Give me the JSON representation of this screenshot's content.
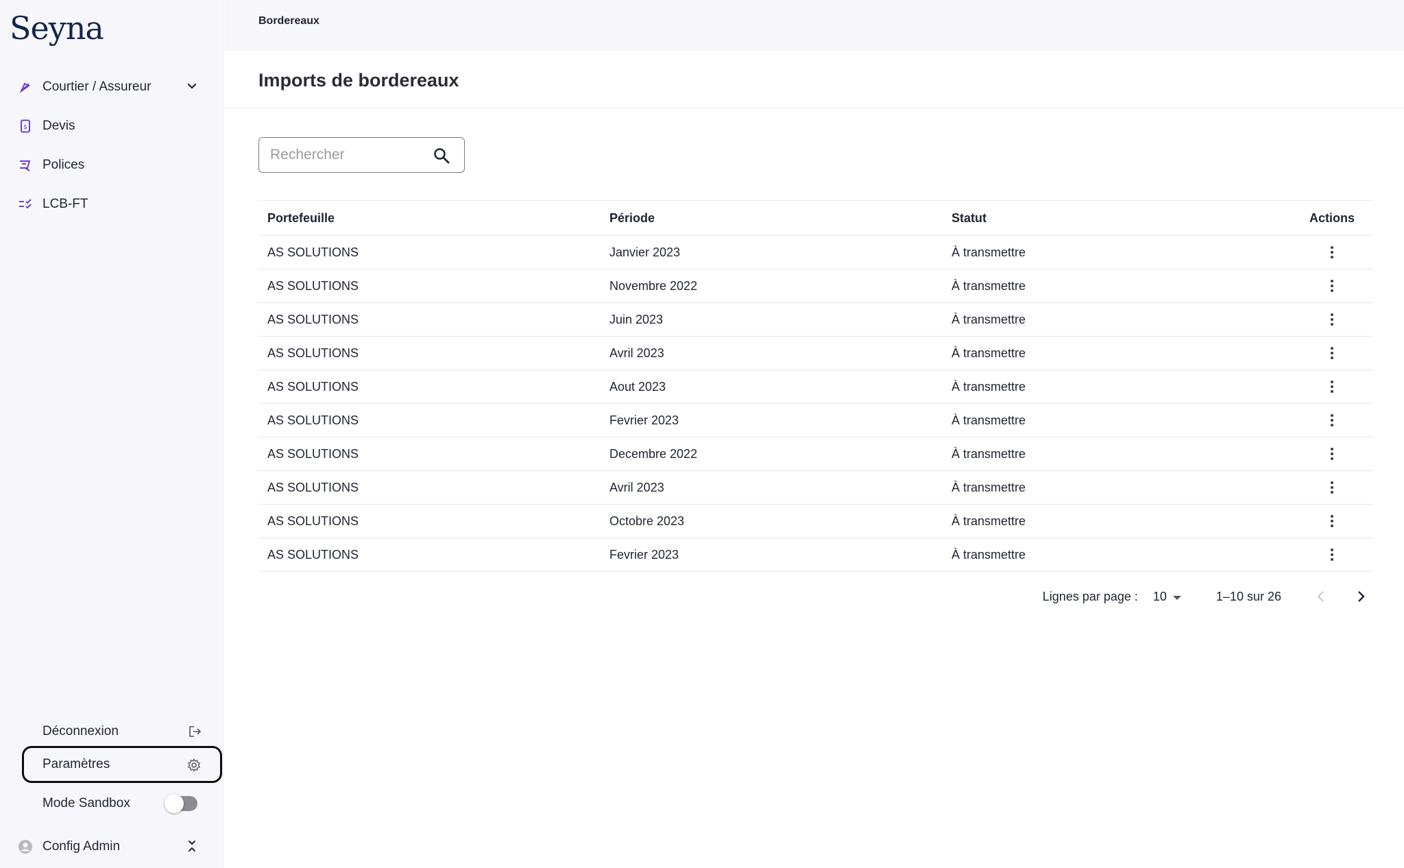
{
  "brand": {
    "name": "Seyna",
    "accent": "#6b3fd9"
  },
  "sidebar": {
    "items": [
      {
        "label": "Courtier / Assureur",
        "icon": "pen-nib-icon",
        "has_chevron": true
      },
      {
        "label": "Devis",
        "icon": "document-dollar-icon"
      },
      {
        "label": "Polices",
        "icon": "certificate-icon"
      },
      {
        "label": "LCB-FT",
        "icon": "checklist-icon"
      }
    ],
    "logout_label": "Déconnexion",
    "settings_label": "Paramètres",
    "sandbox_label": "Mode Sandbox",
    "sandbox_enabled": false,
    "user_label": "Config Admin"
  },
  "header": {
    "breadcrumb": "Bordereaux",
    "title": "Imports de bordereaux"
  },
  "search": {
    "placeholder": "Rechercher",
    "value": ""
  },
  "table": {
    "columns": [
      "Portefeuille",
      "Période",
      "Statut",
      "Actions"
    ],
    "rows": [
      {
        "portefeuille": "AS SOLUTIONS",
        "periode": "Janvier 2023",
        "statut": "À transmettre"
      },
      {
        "portefeuille": "AS SOLUTIONS",
        "periode": "Novembre 2022",
        "statut": "À transmettre"
      },
      {
        "portefeuille": "AS SOLUTIONS",
        "periode": "Juin 2023",
        "statut": "À transmettre"
      },
      {
        "portefeuille": "AS SOLUTIONS",
        "periode": "Avril 2023",
        "statut": "À transmettre"
      },
      {
        "portefeuille": "AS SOLUTIONS",
        "periode": "Aout 2023",
        "statut": "À transmettre"
      },
      {
        "portefeuille": "AS SOLUTIONS",
        "periode": "Fevrier 2023",
        "statut": "À transmettre"
      },
      {
        "portefeuille": "AS SOLUTIONS",
        "periode": "Decembre 2022",
        "statut": "À transmettre"
      },
      {
        "portefeuille": "AS SOLUTIONS",
        "periode": "Avril 2023",
        "statut": "À transmettre"
      },
      {
        "portefeuille": "AS SOLUTIONS",
        "periode": "Octobre 2023",
        "statut": "À transmettre"
      },
      {
        "portefeuille": "AS SOLUTIONS",
        "periode": "Fevrier 2023",
        "statut": "À transmettre"
      }
    ]
  },
  "pagination": {
    "rows_per_page_label": "Lignes par page :",
    "rows_per_page": "10",
    "range": "1–10 sur 26"
  }
}
